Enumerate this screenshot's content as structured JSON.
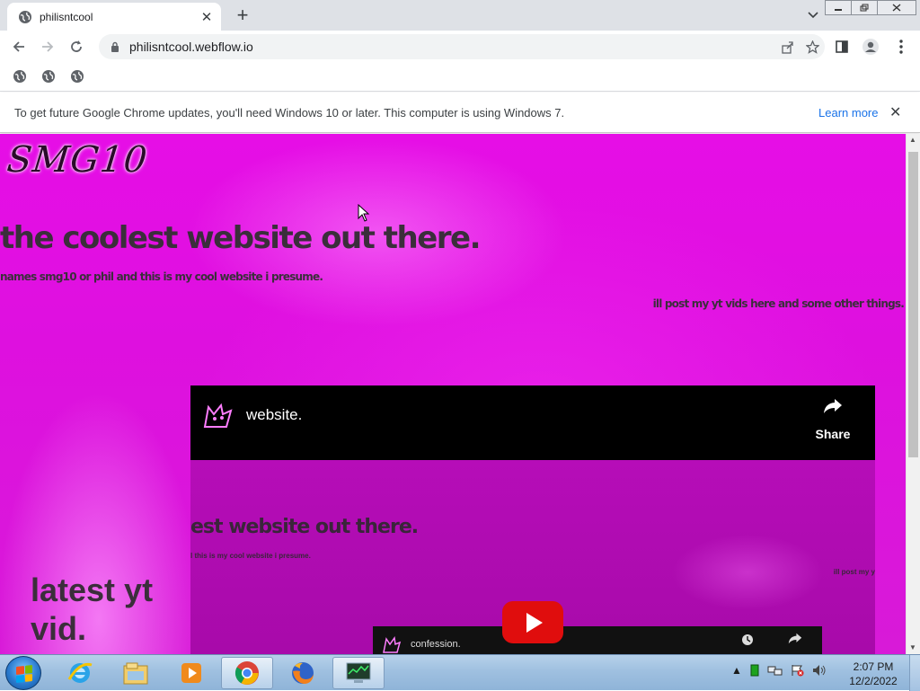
{
  "browser": {
    "tab_title": "philisntcool",
    "tab_close": "✕",
    "new_tab": "+",
    "url": "philisntcool.webflow.io",
    "window_controls": [
      "minimize",
      "restore",
      "close"
    ]
  },
  "infobar": {
    "message": "To get future Google Chrome updates, you'll need Windows 10 or later. This computer is using Windows 7.",
    "link": "Learn more",
    "close": "✕"
  },
  "page": {
    "logo": "SMG10",
    "hero": "the coolest website out there.",
    "intro": "names smg10 or phil and this is my cool website i presume.",
    "note": "ill post my yt vids here and some other things.",
    "latest_heading": "latest yt vid."
  },
  "video": {
    "title": "website.",
    "share_label": "Share",
    "inner_hero": "est website out there.",
    "inner_sub1": "l this is my cool website i presume.",
    "inner_sub2": "ill post my y",
    "mini_title": "confession."
  },
  "taskbar": {
    "time": "2:07 PM",
    "date": "12/2/2022",
    "apps": [
      "internet-explorer",
      "file-explorer",
      "media-player",
      "chrome",
      "firefox",
      "task-manager"
    ]
  },
  "colors": {
    "page_magenta": "#e60ee6",
    "heading_text": "#3b2e3b",
    "link_blue": "#1a73e8",
    "youtube_red": "#e00d0d"
  }
}
